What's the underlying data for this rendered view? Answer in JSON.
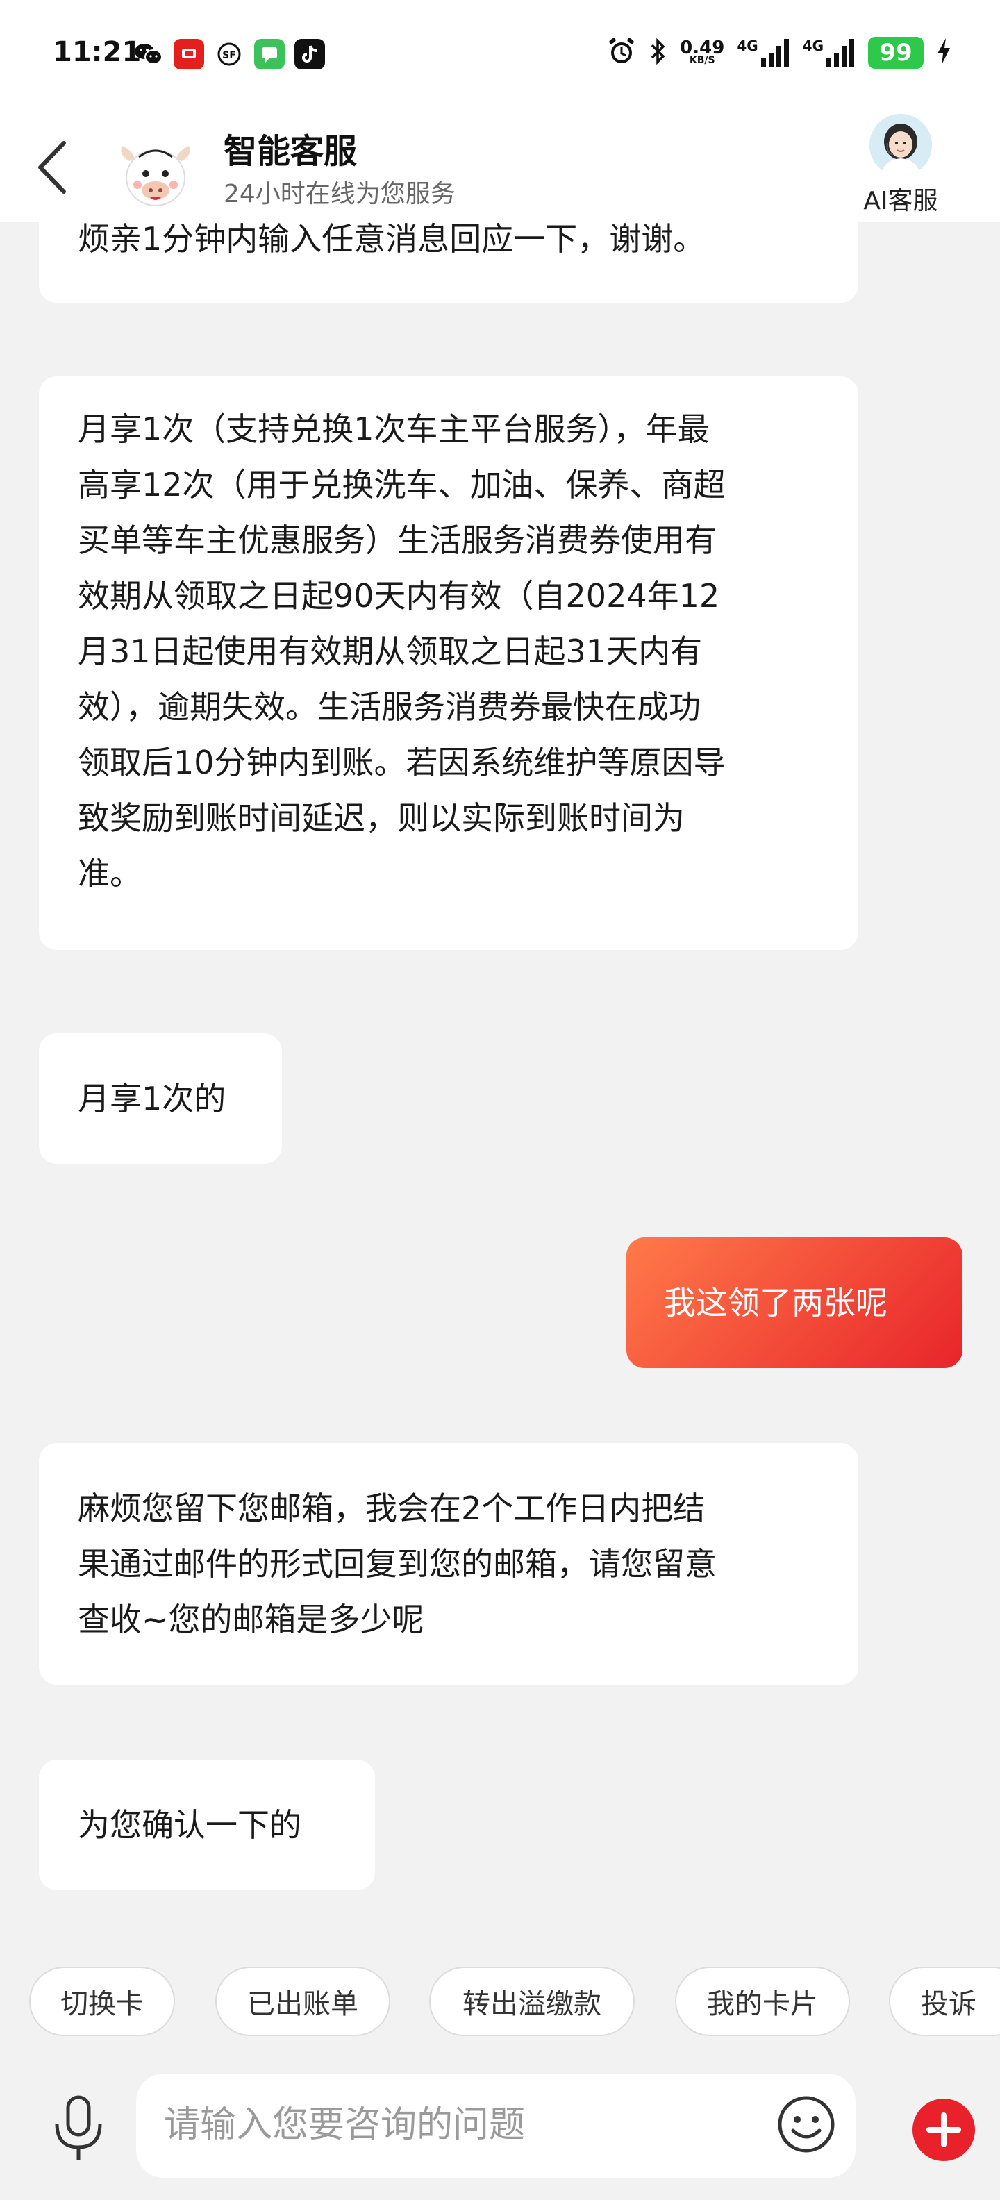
{
  "status_bar": {
    "time": "11:21",
    "net_speed": "0.49",
    "net_unit": "KB/S",
    "signal_1": "4G",
    "signal_2": "4G",
    "battery": "99"
  },
  "header": {
    "title": "智能客服",
    "subtitle": "24小时在线为您服务",
    "ai_agent_label": "AI客服"
  },
  "messages": [
    {
      "from": "bot",
      "lines": [
        "烦亲1分钟内输入任意消息回应一下，谢谢。"
      ]
    },
    {
      "from": "bot",
      "lines": [
        "月享1次（支持兑换1次车主平台服务），年最",
        "高享12次（用于兑换洗车、加油、保养、商超",
        "买单等车主优惠服务）生活服务消费券使用有",
        "效期从领取之日起90天内有效（自2024年12",
        "月31日起使用有效期从领取之日起31天内有",
        "效），逾期失效。生活服务消费券最快在成功",
        "领取后10分钟内到账。若因系统维护等原因导",
        "致奖励到账时间延迟，则以实际到账时间为",
        "准。"
      ]
    },
    {
      "from": "bot",
      "lines": [
        "月享1次的"
      ]
    },
    {
      "from": "user",
      "lines": [
        "我这领了两张呢"
      ]
    },
    {
      "from": "bot",
      "lines": [
        "麻烦您留下您邮箱，我会在2个工作日内把结",
        "果通过邮件的形式回复到您的邮箱，请您留意",
        "查收~您的邮箱是多少呢"
      ]
    },
    {
      "from": "bot",
      "lines": [
        "为您确认一下的"
      ]
    }
  ],
  "quick_replies": [
    "切换卡",
    "已出账单",
    "转出溢缴款",
    "我的卡片",
    "投诉"
  ],
  "input": {
    "placeholder": "请输入您要咨询的问题",
    "value": ""
  },
  "colors": {
    "accent": "#e8242a",
    "user_bubble_start": "#ff7a4a",
    "user_bubble_end": "#e8242a",
    "background": "#f2f2f2"
  }
}
